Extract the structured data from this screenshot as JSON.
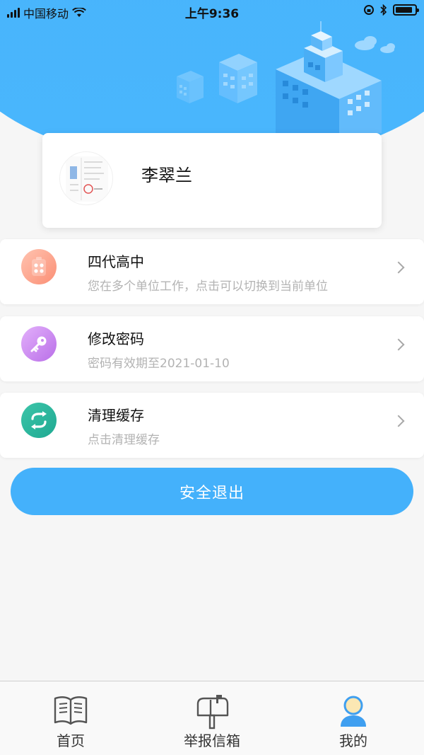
{
  "status_bar": {
    "carrier": "中国移动",
    "time": "上午9:36"
  },
  "profile": {
    "name": "李翠兰"
  },
  "menu": [
    {
      "title": "四代高中",
      "subtitle": "您在多个单位工作，点击可以切换到当前单位",
      "icon": "building-icon",
      "color": "#fb8f75"
    },
    {
      "title": "修改密码",
      "subtitle": "密码有效期至2021-01-10",
      "icon": "key-icon",
      "color": "#c882ef"
    },
    {
      "title": "清理缓存",
      "subtitle": "点击清理缓存",
      "icon": "refresh-icon",
      "color": "#26b39c"
    }
  ],
  "logout_label": "安全退出",
  "tabs": [
    {
      "label": "首页",
      "icon": "book-icon"
    },
    {
      "label": "举报信箱",
      "icon": "mailbox-icon"
    },
    {
      "label": "我的",
      "icon": "user-icon",
      "active": true
    }
  ],
  "colors": {
    "header": "#48b3fb",
    "button": "#44b1fb"
  }
}
